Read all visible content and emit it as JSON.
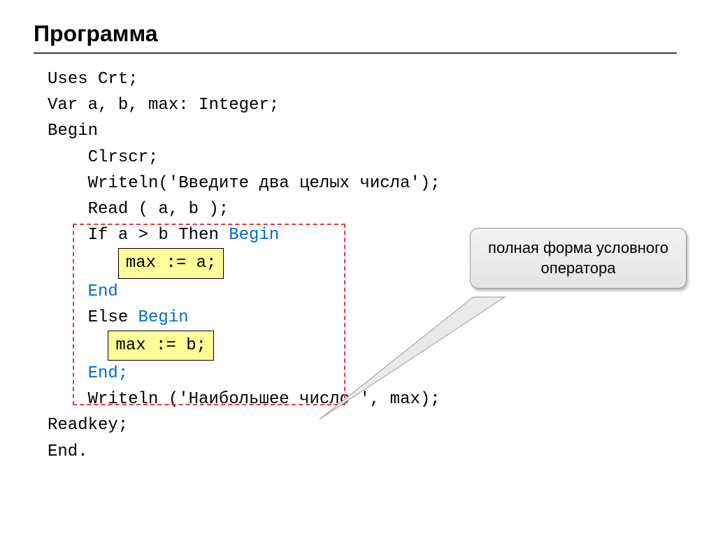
{
  "title": "Программа",
  "code": {
    "l1": "Uses Crt;",
    "l2": "Var a, b, max: Integer;",
    "l3": "Begin",
    "l4": "    Clrscr;",
    "l5_a": "    Writeln('",
    "l5_b": "Введите два целых числа",
    "l5_c": "');",
    "l6": "    Read ( a, b );",
    "l7_a": "    If a > b Then ",
    "l7_b": "Begin",
    "l8_hl": "max := a;",
    "l9": "    End",
    "l10_a": "    Else ",
    "l10_b": "Begin",
    "l11_hl": "max := b;",
    "l12": "    End;",
    "l13_a": "    Writeln ('Наибольшее число ', max);",
    "l14": "Readkey;",
    "l15": "End."
  },
  "callout": "полная форма условного оператора"
}
